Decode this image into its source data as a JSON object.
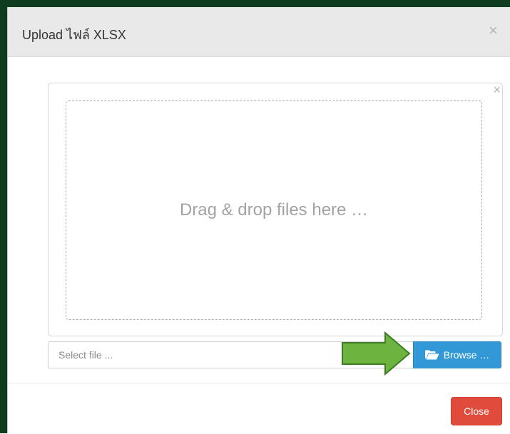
{
  "modal": {
    "title": "Upload ไฟล์ XLSX",
    "close_x": "×"
  },
  "dropzone": {
    "remove_x": "×",
    "text": "Drag & drop files here …"
  },
  "file_input": {
    "placeholder": "Select file ..."
  },
  "browse_button": {
    "label": "Browse …",
    "icon": "folder-open-icon"
  },
  "footer": {
    "close_label": "Close"
  },
  "colors": {
    "browse": "#3399d6",
    "close": "#e04b3b",
    "arrow": "#6db33f"
  }
}
